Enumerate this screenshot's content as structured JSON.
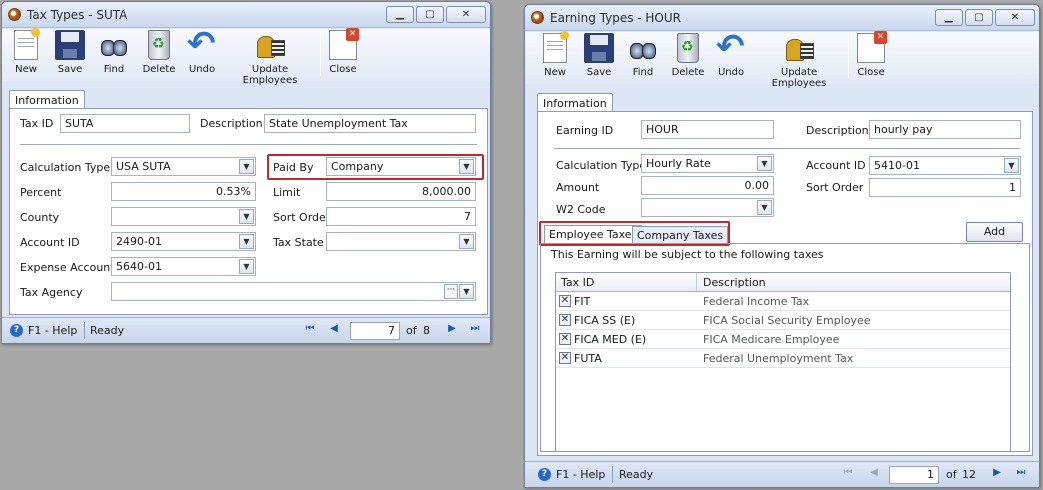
{
  "toolbar": {
    "new": "New",
    "save": "Save",
    "find": "Find",
    "delete": "Delete",
    "undo": "Undo",
    "update_employees": "Update Employees",
    "close": "Close"
  },
  "tax_window": {
    "title": "Tax Types - SUTA",
    "tab_information": "Information",
    "tax_id_label": "Tax ID",
    "tax_id_value": "SUTA",
    "description_label": "Description",
    "description_value": "State Unemployment Tax",
    "calc_type_label": "Calculation Type",
    "calc_type_value": "USA SUTA",
    "paid_by_label": "Paid By",
    "paid_by_value": "Company",
    "percent_label": "Percent",
    "percent_value": "0.53%",
    "limit_label": "Limit",
    "limit_value": "8,000.00",
    "county_label": "County",
    "county_value": "",
    "sort_order_label": "Sort Order",
    "sort_order_value": "7",
    "account_id_label": "Account ID",
    "account_id_value": "2490-01",
    "tax_state_label": "Tax State",
    "tax_state_value": "",
    "expense_account_label": "Expense Account",
    "expense_account_value": "5640-01",
    "tax_agency_label": "Tax Agency",
    "tax_agency_value": "",
    "status": {
      "help": "F1 - Help",
      "state": "Ready",
      "page": "7",
      "of": "of",
      "total": "8"
    }
  },
  "earning_window": {
    "title": "Earning Types - HOUR",
    "tab_information": "Information",
    "earning_id_label": "Earning ID",
    "earning_id_value": "HOUR",
    "description_label": "Description",
    "description_value": "hourly pay",
    "calc_type_label": "Calculation Type",
    "calc_type_value": "Hourly Rate",
    "account_id_label": "Account ID",
    "account_id_value": "5410-01",
    "amount_label": "Amount",
    "amount_value": "0.00",
    "sort_order_label": "Sort Order",
    "sort_order_value": "1",
    "w2_code_label": "W2 Code",
    "w2_code_value": "",
    "subtab_employee": "Employee Taxes",
    "subtab_company": "Company Taxes",
    "add_button": "Add",
    "subject_text": "This Earning will be subject to the following taxes",
    "grid": {
      "col_tax_id": "Tax ID",
      "col_description": "Description",
      "rows": [
        {
          "tax_id": "FIT",
          "description": "Federal Income Tax"
        },
        {
          "tax_id": "FICA SS (E)",
          "description": "FICA Social Security Employee"
        },
        {
          "tax_id": "FICA MED (E)",
          "description": "FICA Medicare Employee"
        },
        {
          "tax_id": "FUTA",
          "description": "Federal Unemployment Tax"
        }
      ]
    },
    "status": {
      "help": "F1 - Help",
      "state": "Ready",
      "page": "1",
      "of": "of",
      "total": "12"
    }
  },
  "colors": {
    "highlight": "#c0282d",
    "window_bg": "#dce6f4",
    "desktop": "#a8a8a8"
  }
}
